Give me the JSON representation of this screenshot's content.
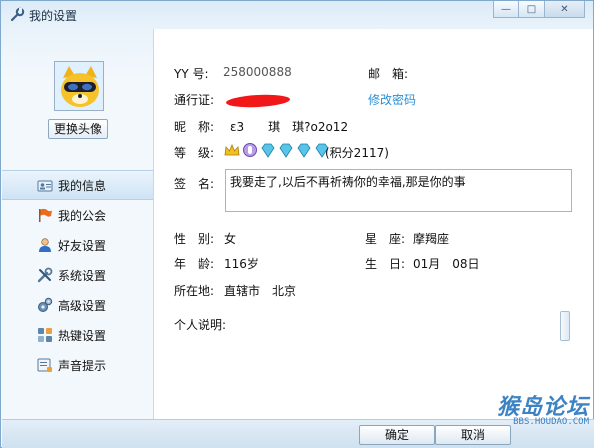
{
  "window": {
    "title": "我的设置",
    "icon": "wrench-icon",
    "controls": [
      "minimize",
      "maximize",
      "close"
    ]
  },
  "sidebar": {
    "avatar_button": "更换头像",
    "items": [
      {
        "label": "我的信息",
        "icon": "id-card-icon",
        "active": true
      },
      {
        "label": "我的公会",
        "icon": "flag-icon",
        "active": false
      },
      {
        "label": "好友设置",
        "icon": "person-icon",
        "active": false
      },
      {
        "label": "系统设置",
        "icon": "tools-icon",
        "active": false
      },
      {
        "label": "高级设置",
        "icon": "gear-advanced-icon",
        "active": false
      },
      {
        "label": "热键设置",
        "icon": "keyboard-icon",
        "active": false
      },
      {
        "label": "声音提示",
        "icon": "sound-icon",
        "active": false
      }
    ]
  },
  "profile": {
    "yy_label": "YY 号:",
    "yy_value": "258000888",
    "email_label": "邮　箱:",
    "email_value": "",
    "pass_label": "通行证:",
    "change_password": "修改密码",
    "nickname_label": "昵　称:",
    "nickname_value": "ε3　　琪　琪?o2o12",
    "level_label": "等　级:",
    "points": "(积分2117)",
    "signature_label": "签　名:",
    "signature_value": "我要走了,以后不再祈祷你的幸福,那是你的事",
    "gender_label": "性　别:",
    "gender_value": "女",
    "zodiac_label": "星　座:",
    "zodiac_value": "摩羯座",
    "age_label": "年　龄:",
    "age_value": "116岁",
    "birthday_label": "生　日:",
    "birthday_value": "01月　08日",
    "location_label": "所在地:",
    "location_value": "直辖市　北京",
    "description_label": "个人说明:"
  },
  "footer": {
    "ok_label": "确定",
    "cancel_label": "取消"
  },
  "watermark": {
    "main": "猴岛论坛",
    "sub": "BBS.HOUDAO.COM"
  },
  "colors": {
    "accent_link": "#2a8fd6",
    "redaction": "#f01818"
  }
}
